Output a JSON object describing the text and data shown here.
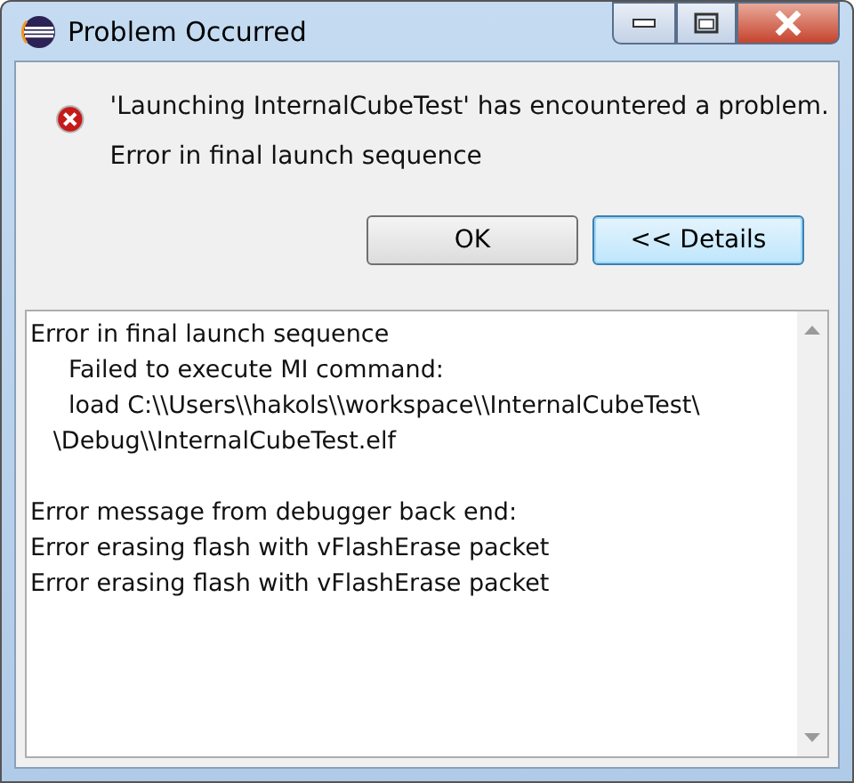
{
  "window": {
    "title": "Problem Occurred"
  },
  "message": {
    "title": "'Launching InternalCubeTest' has encountered a problem.",
    "detail": "Error in final launch sequence"
  },
  "buttons": [
    {
      "label": "OK",
      "default": false
    },
    {
      "label": "<< Details",
      "default": true
    }
  ],
  "details": {
    "paragraphs": [
      [
        "Error in final launch sequence",
        "     Failed to execute MI command:",
        "     load C:\\\\Users\\\\hakols\\\\workspace\\\\InternalCubeTest\\",
        "   \\Debug\\\\InternalCubeTest.elf"
      ],
      [
        "Error message from debugger back end:",
        "Error erasing flash with vFlashErase packet",
        "Error erasing flash with vFlashErase packet"
      ]
    ]
  }
}
